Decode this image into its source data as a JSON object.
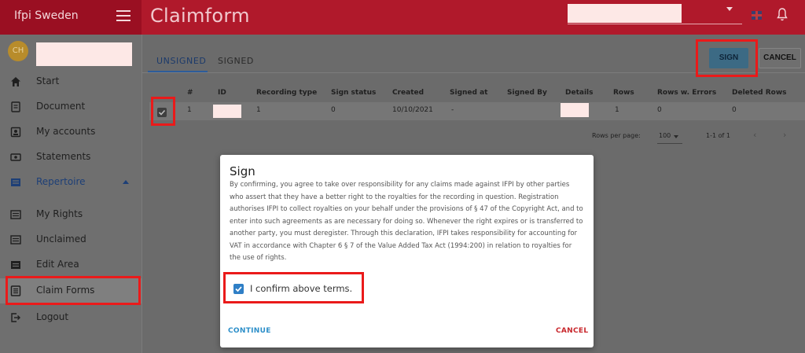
{
  "app": {
    "brand": "Ifpi Sweden",
    "page_title": "Claimform"
  },
  "user": {
    "initials": "CH"
  },
  "sidebar": {
    "items": [
      {
        "label": "Start",
        "icon": "home-icon"
      },
      {
        "label": "Document",
        "icon": "document-icon"
      },
      {
        "label": "My accounts",
        "icon": "accounts-icon"
      },
      {
        "label": "Statements",
        "icon": "statements-icon"
      },
      {
        "label": "Repertoire",
        "icon": "repertoire-icon"
      },
      {
        "label": "My Rights",
        "icon": "list-icon"
      },
      {
        "label": "Unclaimed",
        "icon": "list-icon"
      },
      {
        "label": "Edit Area",
        "icon": "list-icon"
      },
      {
        "label": "Claim Forms",
        "icon": "form-icon"
      },
      {
        "label": "Logout",
        "icon": "logout-icon"
      }
    ]
  },
  "tabs": {
    "unsigned": "UNSIGNED",
    "signed": "SIGNED"
  },
  "actions": {
    "sign": "SIGN",
    "cancel": "CANCEL"
  },
  "table": {
    "headers": [
      "#",
      "ID",
      "Recording type",
      "Sign status",
      "Created",
      "Signed at",
      "Signed By",
      "Details",
      "Rows",
      "Rows w. Errors",
      "Deleted Rows"
    ],
    "row": {
      "num": "1",
      "recording_type": "1",
      "sign_status": "0",
      "created": "10/10/2021",
      "signed_at": "-",
      "rows": "1",
      "rows_errors": "0",
      "deleted_rows": "0"
    }
  },
  "pagination": {
    "rows_per_page_label": "Rows per page:",
    "rows_per_page": "100",
    "range": "1-1 of 1"
  },
  "dialog": {
    "title": "Sign",
    "body": "By confirming, you agree to take over responsibility for any claims made against IFPI by other parties who assert that they have a better right to the royalties for the recording in question. Registration authorises IFPI to collect royalties on your behalf under the provisions of § 47 of the Copyright Act, and to enter into such agreements as are necessary for doing so. Whenever the right expires or is transferred to another party, you must deregister. Through this declaration, IFPI takes responsibility for accounting for VAT in accordance with Chapter 6 § 7 of the Value Added Tax Act (1994:200) in relation to royalties for the use of rights.",
    "confirm_label": "I confirm above terms.",
    "confirm_checked": true,
    "continue": "CONTINUE",
    "cancel": "CANCEL"
  },
  "colors": {
    "topbar": "#b0192b",
    "highlight": "#ea1a1a",
    "accent": "#2f7fc6",
    "cancel": "#c8262b"
  }
}
